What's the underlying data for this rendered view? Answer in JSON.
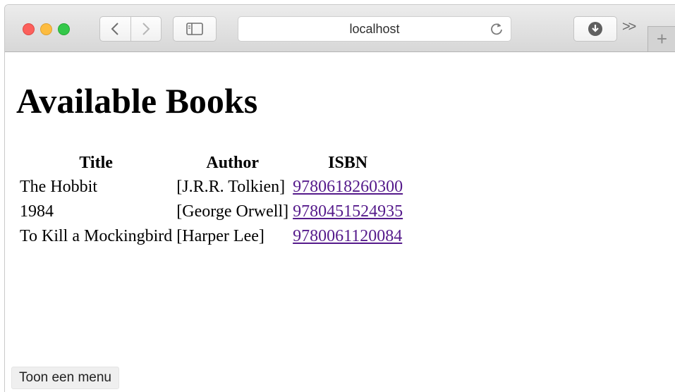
{
  "toolbar": {
    "address": "localhost",
    "overflow_label": ">>",
    "new_tab_label": "+"
  },
  "page": {
    "heading": "Available Books",
    "columns": [
      "Title",
      "Author",
      "ISBN"
    ],
    "rows": [
      {
        "title": "The Hobbit",
        "author": "[J.R.R. Tolkien]",
        "isbn": "9780618260300"
      },
      {
        "title": "1984",
        "author": "[George Orwell]",
        "isbn": "9780451524935"
      },
      {
        "title": "To Kill a Mockingbird",
        "author": "[Harper Lee]",
        "isbn": "9780061120084"
      }
    ]
  },
  "status_bar": {
    "label": "Toon een menu"
  },
  "colors": {
    "link": "#551a8b",
    "close": "#fc605c",
    "minimize": "#fdbc40",
    "zoom": "#34c84a"
  },
  "icons": [
    "back-chevron-icon",
    "forward-chevron-icon",
    "sidebar-icon",
    "reload-icon",
    "download-icon"
  ]
}
